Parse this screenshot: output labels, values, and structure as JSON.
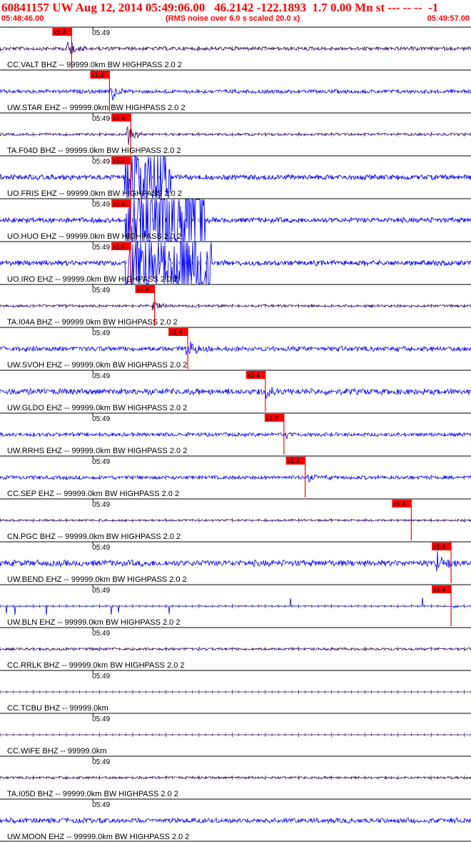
{
  "header": {
    "title": "60841157 UW Aug 12, 2014 05:49:06.00   46.2142 -122.1893  1.7 0.00 Mn st --- -- --  -1",
    "start_time": "05:48:46.00",
    "rms_note": "(RMS noise over 6.0 s scaled 20.0 x)",
    "end_time": "05:49:57.00"
  },
  "colors": {
    "header_red": "#ff0000",
    "trace_blue": "#0000ff",
    "trace_dark": "#330066",
    "pick_red": "#ff0000",
    "axis": "#000000"
  },
  "chart_data": {
    "type": "line",
    "x_range_seconds": [
      0,
      71
    ],
    "x_tick_label": "05:49",
    "x_tick_label_seconds": 14,
    "pick_label": "x1.4",
    "channels": [
      {
        "label": "CC.VALT BHZ -- 99999.0km BW  HIGHPASS  2.0  2",
        "color": "dark",
        "pick_s": 10.8,
        "event_s": 10.0,
        "event_amp": 16,
        "event_dur": 4,
        "noise": 3
      },
      {
        "label": "UW.STAR EHZ -- 99999.0km BW  HIGHPASS  2.0  2",
        "color": "blue",
        "pick_s": 16.5,
        "event_s": 16.6,
        "event_amp": 20,
        "event_dur": 3,
        "noise": 3
      },
      {
        "label": "TA.F04D BHZ -- 99999.0km BW  HIGHPASS  2.0  2",
        "color": "dark",
        "pick_s": 19.7,
        "event_s": 19.0,
        "event_amp": 18,
        "event_dur": 4,
        "noise": 2
      },
      {
        "label": "UO.FRIS EHZ -- 99999.0km BW  HIGHPASS  2.0  2",
        "color": "blue",
        "pick_s": 19.7,
        "event_s": 18.8,
        "event_amp": 60,
        "event_dur": 7,
        "noise": 4,
        "clipped": true
      },
      {
        "label": "UO.HUO EHZ -- 99999.0km BW  HIGHPASS  2.0  2",
        "color": "blue",
        "pick_s": 19.7,
        "event_s": 18.9,
        "event_amp": 60,
        "event_dur": 12,
        "noise": 4,
        "clipped": true
      },
      {
        "label": "UO.IRO EHZ -- 99999.0km BW  HIGHPASS  2.0  2",
        "color": "blue",
        "pick_s": 19.7,
        "event_s": 18.9,
        "event_amp": 60,
        "event_dur": 13,
        "noise": 4,
        "clipped": true
      },
      {
        "label": "TA.I04A BHZ -- 99999.0km BW  HIGHPASS  2.0  2",
        "color": "dark",
        "pick_s": 23.3,
        "event_s": 22.9,
        "event_amp": 12,
        "event_dur": 3,
        "noise": 2
      },
      {
        "label": "UW.SVOH EHZ -- 99999.0km BW  HIGHPASS  2.0  2",
        "color": "blue",
        "pick_s": 28.3,
        "event_s": 27.8,
        "event_amp": 14,
        "event_dur": 5,
        "noise": 4
      },
      {
        "label": "UW.GLDO EHZ -- 99999.0km BW  HIGHPASS  2.0  2",
        "color": "blue",
        "pick_s": 40.0,
        "event_s": 39.3,
        "event_amp": 12,
        "event_dur": 4,
        "noise": 5
      },
      {
        "label": "UW.RRHS EHZ -- 99999.0km BW  HIGHPASS  2.0  2",
        "color": "blue",
        "pick_s": 42.8,
        "event_s": 43.0,
        "event_amp": 6,
        "event_dur": 3,
        "noise": 3
      },
      {
        "label": "CC.SEP EHZ -- 99999.0km BW  HIGHPASS  2.0  2",
        "color": "blue",
        "pick_s": 46.0,
        "event_s": 46.2,
        "event_amp": 10,
        "event_dur": 5,
        "noise": 3
      },
      {
        "label": "CN.PGC BHZ -- 99999.0km BW  HIGHPASS  2.0  2",
        "color": "dark",
        "pick_s": 62.0,
        "event_s": 62.0,
        "event_amp": 0,
        "event_dur": 0,
        "noise": 1.5
      },
      {
        "label": "UW.BEND EHZ -- 99999.0km BW  HIGHPASS  2.0  2",
        "color": "blue",
        "pick_s": 68.0,
        "event_s": 65.5,
        "event_amp": 20,
        "event_dur": 5,
        "noise": 5
      },
      {
        "label": "UW.BLN EHZ -- 99999.0km BW  HIGHPASS  2.0  2",
        "color": "blue",
        "pick_s": 68.0,
        "event_s": 68.2,
        "event_amp": 6,
        "event_dur": 2,
        "noise": 0.6,
        "spiky": true
      },
      {
        "label": "CC.RRLK BHZ -- 99999.0km BW  HIGHPASS  2.0  2",
        "color": "dark",
        "noise": 2
      },
      {
        "label": "CC.TCBU BHZ -- 99999.0km",
        "color": "dark",
        "flat": true
      },
      {
        "label": "CC.WIFE BHZ -- 99999.0km",
        "color": "dark",
        "flat": true
      },
      {
        "label": "TA.I05D BHZ -- 99999.0km BW  HIGHPASS  2.0  2",
        "color": "dark",
        "noise": 2
      },
      {
        "label": "UW.MOON EHZ -- 99999.0km BW  HIGHPASS  2.0  2",
        "color": "blue",
        "noise": 4
      }
    ]
  }
}
